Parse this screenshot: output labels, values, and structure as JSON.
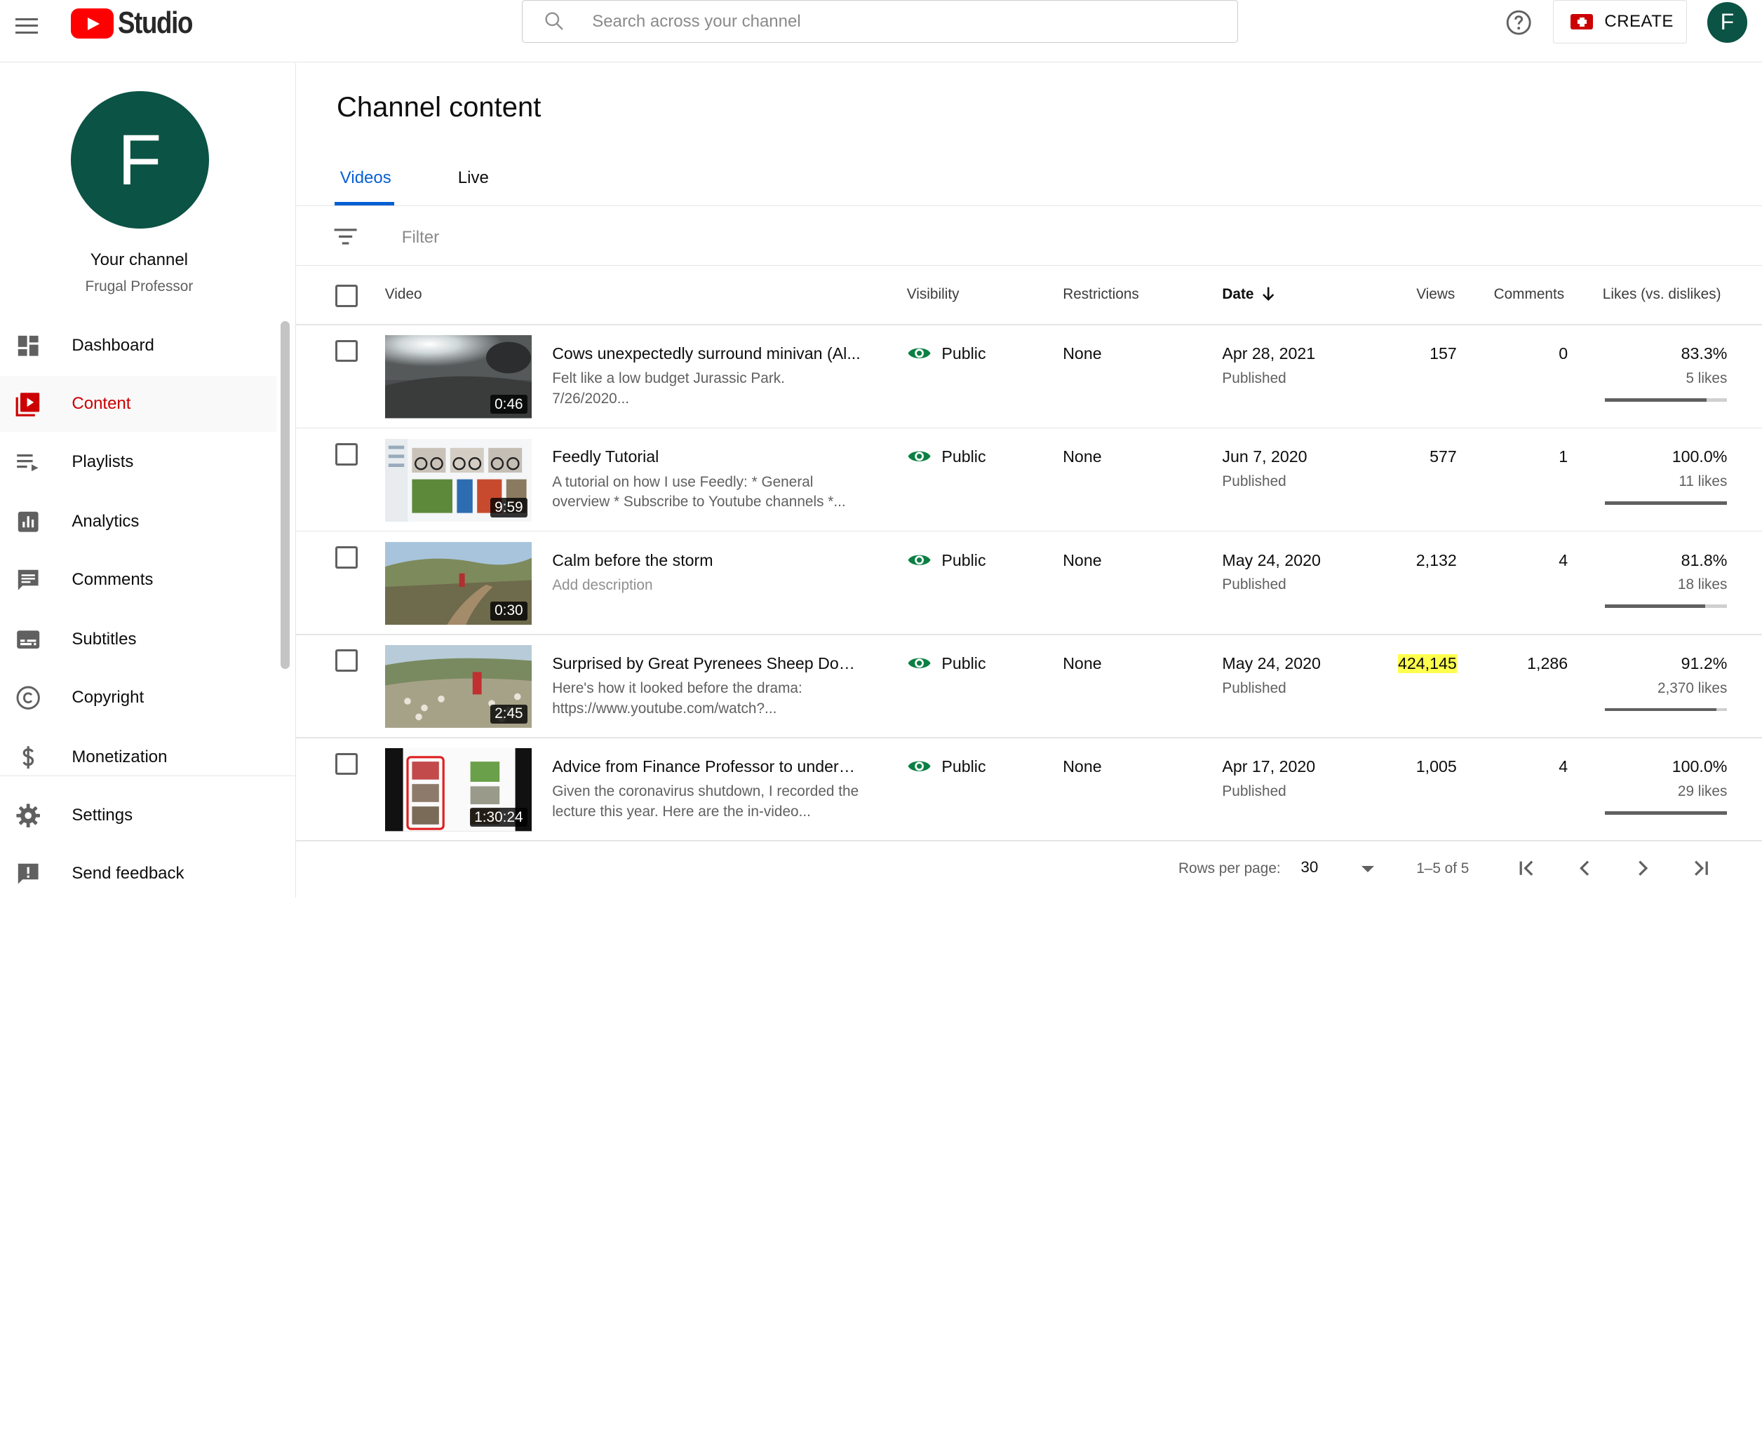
{
  "header": {
    "logo_text": "Studio",
    "search_placeholder": "Search across your channel",
    "create_label": "CREATE",
    "avatar_letter": "F"
  },
  "sidebar": {
    "avatar_letter": "F",
    "channel_title": "Your channel",
    "channel_name": "Frugal Professor",
    "items": [
      {
        "label": "Dashboard",
        "icon": "dashboard-icon"
      },
      {
        "label": "Content",
        "icon": "content-icon",
        "active": true
      },
      {
        "label": "Playlists",
        "icon": "playlists-icon"
      },
      {
        "label": "Analytics",
        "icon": "analytics-icon"
      },
      {
        "label": "Comments",
        "icon": "comments-icon"
      },
      {
        "label": "Subtitles",
        "icon": "subtitles-icon"
      },
      {
        "label": "Copyright",
        "icon": "copyright-icon"
      },
      {
        "label": "Monetization",
        "icon": "dollar-icon"
      },
      {
        "label": "Settings",
        "icon": "gear-icon"
      },
      {
        "label": "Send feedback",
        "icon": "feedback-icon"
      }
    ]
  },
  "main": {
    "title": "Channel content",
    "tabs": [
      {
        "label": "Videos",
        "active": true
      },
      {
        "label": "Live"
      }
    ],
    "filter_placeholder": "Filter",
    "columns": {
      "video": "Video",
      "visibility": "Visibility",
      "restrictions": "Restrictions",
      "date": "Date",
      "views": "Views",
      "comments": "Comments",
      "likes": "Likes (vs. dislikes)"
    },
    "rows": [
      {
        "duration": "0:46",
        "title": "Cows unexpectedly surround minivan (Al...",
        "description": "Felt like a low budget Jurassic Park. 7/26/2020...",
        "visibility": "Public",
        "restrictions": "None",
        "date": "Apr 28, 2021",
        "status": "Published",
        "views": "157",
        "comments": "0",
        "likes_pct": "83.3%",
        "likes_count": "5 likes",
        "likes_ratio": 0.833
      },
      {
        "duration": "9:59",
        "title": "Feedly Tutorial",
        "description": "A tutorial on how I use Feedly: * General overview * Subscribe to Youtube channels *...",
        "visibility": "Public",
        "restrictions": "None",
        "date": "Jun 7, 2020",
        "status": "Published",
        "views": "577",
        "comments": "1",
        "likes_pct": "100.0%",
        "likes_count": "11 likes",
        "likes_ratio": 1.0
      },
      {
        "duration": "0:30",
        "title": "Calm before the storm",
        "description": "Add description",
        "visibility": "Public",
        "restrictions": "None",
        "date": "May 24, 2020",
        "status": "Published",
        "views": "2,132",
        "comments": "4",
        "likes_pct": "81.8%",
        "likes_count": "18 likes",
        "likes_ratio": 0.818
      },
      {
        "duration": "2:45",
        "title": "Surprised by Great Pyrenees Sheep Dogs ...",
        "description": "Here's how it looked before the drama: https://www.youtube.com/watch?...",
        "visibility": "Public",
        "restrictions": "None",
        "date": "May 24, 2020",
        "status": "Published",
        "views": "424,145",
        "comments": "1,286",
        "likes_pct": "91.2%",
        "likes_count": "2,370 likes",
        "likes_ratio": 0.912
      },
      {
        "duration": "1:30:24",
        "title": "Advice from Finance Professor to undergr...",
        "description": "Given the coronavirus shutdown, I recorded the lecture this year. Here are the in-video...",
        "visibility": "Public",
        "restrictions": "None",
        "date": "Apr 17, 2020",
        "status": "Published",
        "views": "1,005",
        "comments": "4",
        "likes_pct": "100.0%",
        "likes_count": "29 likes",
        "likes_ratio": 1.0
      }
    ]
  },
  "pagination": {
    "rows_per_page_label": "Rows per page:",
    "rows_per_page": "30",
    "range": "1–5 of 5"
  },
  "colors": {
    "accent_blue": "#065fd4",
    "active_red": "#cc0000",
    "public_green": "#0a8043",
    "avatar": "#0b5345",
    "highlight": "#ffff4d"
  }
}
